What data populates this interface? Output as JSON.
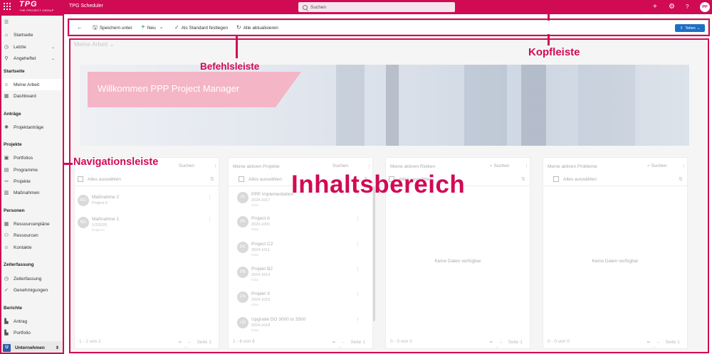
{
  "header": {
    "logo_text": "TPG",
    "logo_sub": "THE PROJECT GROUP",
    "app_name": "TPG Scheduler",
    "search_placeholder": "Suchen",
    "add_icon": "plus-icon",
    "settings_icon": "gear-icon",
    "help_icon": "question-icon",
    "avatar_initials": "PP"
  },
  "sidebar": {
    "top": [
      {
        "label": "Startseite",
        "icon": "home-icon"
      },
      {
        "label": "Letzte",
        "icon": "clock-icon"
      },
      {
        "label": "Angeheftet",
        "icon": "pin-icon"
      }
    ],
    "sections": {
      "startseite": "Startseite",
      "antraege": "Anträge",
      "projekte": "Projekte",
      "personen": "Personen",
      "zeiterfassung": "Zeiterfassung",
      "berichte": "Berichte"
    },
    "startseite_items": [
      "Meine Arbeit",
      "Dashboard"
    ],
    "antraege_items": [
      "Projektanträge"
    ],
    "projekte_items": [
      "Portfolios",
      "Programme",
      "Projekte",
      "Maßnahmen"
    ],
    "personen_items": [
      "Ressourcenpläne",
      "Ressourcen",
      "Kontakte"
    ],
    "zeiterfassung_items": [
      "Zeiterfassung",
      "Genehmigungen"
    ],
    "berichte_items": [
      "Antrag",
      "Portfolio"
    ],
    "bottom": {
      "initial": "U",
      "label": "Unternehmen"
    }
  },
  "commandbar": {
    "save_as": "Speichern unter",
    "new": "Neu",
    "set_default": "Als Standard festlegen",
    "refresh_all": "Alle aktualisieren",
    "share": "Teilen"
  },
  "content": {
    "view_title": "Meine Arbeit",
    "banner_text": "Willkommen PPP Project Manager",
    "cards": [
      {
        "title": "",
        "search": "Suchen",
        "select_all": "Alles auswählen",
        "items": [
          {
            "initials": "MO",
            "name": "Maßnahme 2",
            "sub": "Project 0",
            "extra": ""
          },
          {
            "initials": "M1",
            "name": "Maßnahme 1",
            "sub": "1/2/2025",
            "extra": "Project 0"
          }
        ],
        "footer": "1 - 2 von 2",
        "page": "Seite 1"
      },
      {
        "title": "Meine aktiven Projekte",
        "search": "Suchen",
        "select_all": "Alles auswählen",
        "items": [
          {
            "initials": "PI",
            "name": "PPP Implementation",
            "sub": "2024-1017",
            "extra": "Grün"
          },
          {
            "initials": "PA",
            "name": "Project A",
            "sub": "2023-1001",
            "extra": "Grün"
          },
          {
            "initials": "PC",
            "name": "Project C2",
            "sub": "2024-1011",
            "extra": "Grün"
          },
          {
            "initials": "PB",
            "name": "Projekt B2",
            "sub": "2024-1014",
            "extra": "Grün"
          },
          {
            "initials": "PX",
            "name": "Projekt X",
            "sub": "2024-1016",
            "extra": "Grün"
          },
          {
            "initials": "UD",
            "name": "Upgrade DO 3000 to 3500",
            "sub": "2024-1018",
            "extra": "Grün"
          }
        ],
        "footer": "1 - 6 von 6",
        "page": "Seite 1"
      },
      {
        "title": "Meine aktiven Risiken",
        "search": "Suchen",
        "select_all": "Alles auswählen",
        "empty": "Keine Daten verfügbar",
        "footer": "0 - 0 von 0",
        "page": "Seite 1"
      },
      {
        "title": "Meine aktiven Probleme",
        "search": "Suchen",
        "select_all": "Alles auswählen",
        "empty": "Keine Daten verfügbar",
        "footer": "0 - 0 von 0",
        "page": "Seite 1"
      }
    ]
  },
  "annotations": {
    "kopfleiste": "Kopfleiste",
    "befehlsleiste": "Befehlsleiste",
    "navigationsleiste": "Navigationsleiste",
    "inhaltsbereich": "Inhaltsbereich",
    "color": "#d10a54"
  }
}
